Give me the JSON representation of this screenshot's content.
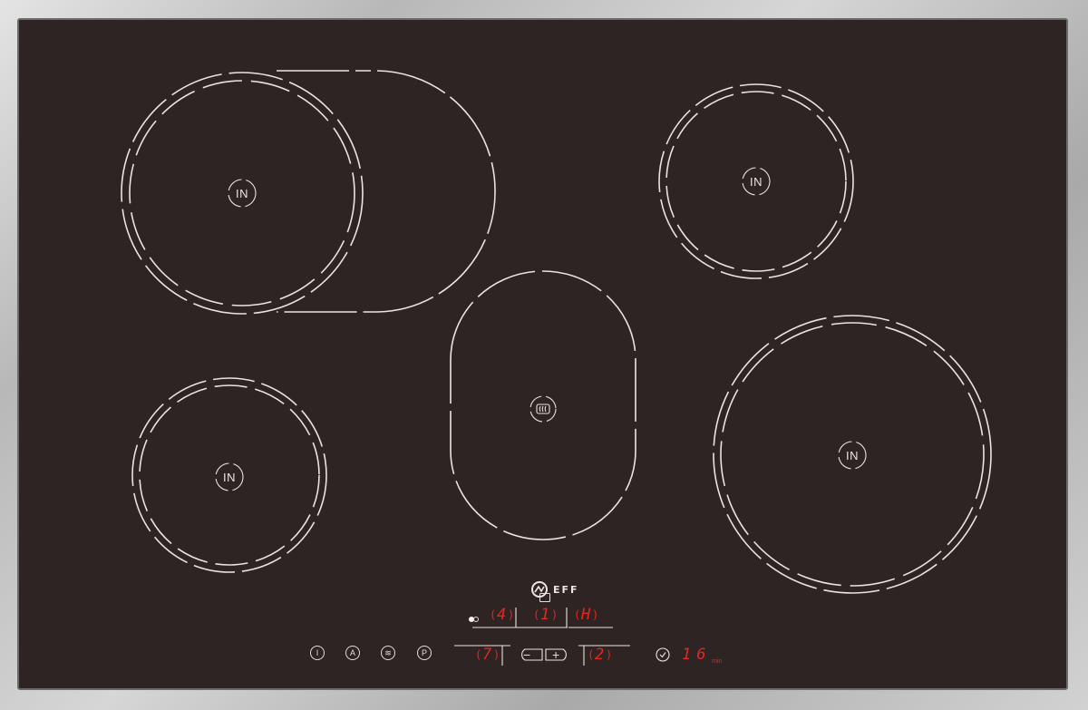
{
  "zones": {
    "front_left": {
      "label": "IN"
    },
    "rear_left": {
      "label": "IN"
    },
    "rear_right": {
      "label": "IN"
    },
    "front_right": {
      "label": "IN"
    },
    "center": {
      "icon": "heat-icon"
    }
  },
  "brand": {
    "name": "EFF",
    "logo_icon": "neff-logo-icon"
  },
  "display": {
    "top_row": [
      "4",
      "1",
      "H"
    ],
    "bottom_left": "7",
    "bottom_right": "2",
    "timer": "16",
    "timer_unit": "min"
  },
  "controls": {
    "power_glyph": "I",
    "auto_glyph": "A",
    "keep_warm_glyph": "≋",
    "program_glyph": "P",
    "minus_glyph": "−",
    "plus_glyph": "+"
  },
  "colors": {
    "glass": "#2e2423",
    "frame": "#c9c9c9",
    "digits": "#e8261d",
    "markings": "#e9e4e3"
  }
}
